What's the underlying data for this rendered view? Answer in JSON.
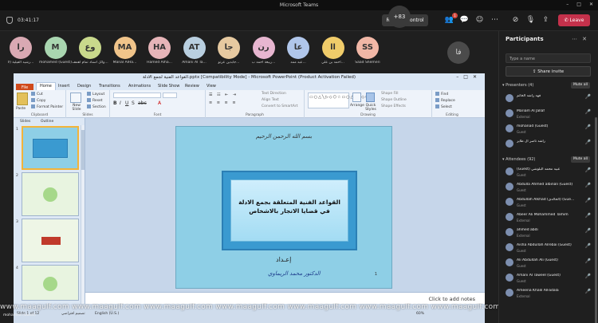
{
  "titlebar": {
    "title": "Microsoft Teams",
    "min": "–",
    "max": "□",
    "close": "✕"
  },
  "meeting": {
    "timer": "03:41:17",
    "request_control": "Request control",
    "leave": "Leave",
    "people_badge": "1"
  },
  "avatars": [
    {
      "initials": "را",
      "name": "رشيد الفيلية (لا...",
      "color": "#d9a9b3"
    },
    {
      "initials": "M",
      "name": "mohamed (Guest)",
      "color": "#a9d6b0"
    },
    {
      "initials": "وع",
      "name": "وائل اسناد تمام أهمف...",
      "color": "#c9d98c"
    },
    {
      "initials": "MA",
      "name": "Manal AlHa...",
      "color": "#f0c48a"
    },
    {
      "initials": "HA",
      "name": "Hamed Alha...",
      "color": "#e6b4b8"
    },
    {
      "initials": "AT",
      "name": "Amani Al Ta...",
      "color": "#b9cfe0"
    },
    {
      "initials": "جا",
      "name": "جابدين عرنو...",
      "color": "#e6c9a0"
    },
    {
      "initials": "رن",
      "name": "ربيعة أحمد ب...",
      "color": "#e7b6d0"
    },
    {
      "initials": "عا",
      "name": "عبد ممد...",
      "color": "#b0c6ea"
    },
    {
      "initials": "اا",
      "name": "أحمد بن علي...",
      "color": "#f0cc6a"
    },
    {
      "initials": "SS",
      "name": "Saad Shemeri",
      "color": "#f1b7a6"
    }
  ],
  "avatars_more": "+83",
  "self_avatar": "فا",
  "ppt": {
    "title": "القواعد الفنية لجمع الادلة.pptx [Compatibility Mode] - Microsoft PowerPoint (Product Activation Failed)",
    "tabs": [
      "File",
      "Home",
      "Insert",
      "Design",
      "Transitions",
      "Animations",
      "Slide Show",
      "Review",
      "View"
    ],
    "ribbon": {
      "clipboard": {
        "paste": "Paste",
        "cut": "Cut",
        "copy": "Copy",
        "format_painter": "Format Painter",
        "label": "Clipboard"
      },
      "slides": {
        "new_slide": "New Slide",
        "layout": "Layout",
        "reset": "Reset",
        "section": "Section",
        "label": "Slides"
      },
      "font_label": "Font",
      "paragraph": {
        "text_direction": "Text Direction",
        "align_text": "Align Text",
        "smartart": "Convert to SmartArt",
        "label": "Paragraph"
      },
      "drawing": {
        "arrange": "Arrange",
        "quick_styles": "Quick Styles",
        "shape_fill": "Shape Fill",
        "shape_outline": "Shape Outline",
        "shape_effects": "Shape Effects",
        "label": "Drawing"
      },
      "editing": {
        "find": "Find",
        "replace": "Replace",
        "select": "Select",
        "label": "Editing"
      }
    },
    "pane_tabs": [
      "Slides",
      "Outline"
    ],
    "slide_numbers": [
      "1",
      "2",
      "3",
      "4"
    ],
    "slide": {
      "bismillah": "بسم الله الرحمن الرحيم",
      "title_line1": "القواعد الفنية المتعلقة بجمع الادلة",
      "title_line2": "في قضايا الاتجار بالاشخاص",
      "prepared": "إعـداد",
      "doctor": "الدكتور محمد الريماوي",
      "page": "1"
    },
    "notes": "Click to add notes",
    "status": {
      "slide": "Slide 1 of 12",
      "theme": "تصميم افتراضي",
      "lang": "English (U.S.)",
      "zoom": "60%"
    }
  },
  "watermark": "www.maagulf.com  www.maagulf.com  www.maagulf.com  www.maagulf.com  www.maagulf.com  www.maagulf.com  www.maagulf.com",
  "self_label": "mohamed (Guest)",
  "panel": {
    "title": "Participants",
    "search_placeholder": "Type a name",
    "share_invite": "Share invite",
    "presenters": "Presenters (4)",
    "attendees": "Attendees (92)",
    "mute_all": "Mute all",
    "presenter_list": [
      {
        "name": "فهد راشد الخاتم",
        "role": ""
      },
      {
        "name": "Mariam Al Jallaf",
        "role": "External"
      },
      {
        "name": "mohanad (Guest)",
        "role": "Guest"
      },
      {
        "name": "راشد ناصر ال طاير",
        "role": ""
      }
    ],
    "attendee_list": [
      {
        "name": "(Guest) عبيد محمد البلوشي",
        "role": "Guest"
      },
      {
        "name": "Abdulla Ahmed albinali (Guest)",
        "role": "Guest"
      },
      {
        "name": "Abdullah Alkhad (الخالدي) (Gue...",
        "role": "Guest"
      },
      {
        "name": "Abeer Ali Mohammed Tamim",
        "role": "External"
      },
      {
        "name": "ahmed abdi",
        "role": "External"
      },
      {
        "name": "Aisha Abdullah Alrebai (Guest)",
        "role": "Guest"
      },
      {
        "name": "Ali Abdullah Ali (Guest)",
        "role": "Guest"
      },
      {
        "name": "Amani Al Taweel (Guest)",
        "role": "Guest"
      },
      {
        "name": "Ameena Khalil AlFadala",
        "role": "External"
      }
    ]
  }
}
